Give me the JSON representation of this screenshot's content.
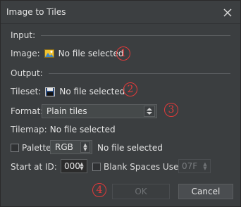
{
  "window": {
    "title": "Image to Tiles"
  },
  "input_section": {
    "label": "Input:"
  },
  "image_row": {
    "label": "Image:",
    "value": "No file selected"
  },
  "output_section": {
    "label": "Output:"
  },
  "tileset_row": {
    "label": "Tileset:",
    "value": "No file selected"
  },
  "format_row": {
    "label": "Format:",
    "selected": "Plain tiles"
  },
  "tilemap_row": {
    "label": "Tilemap:",
    "value": "No file selected"
  },
  "palette_row": {
    "label": "Palette:",
    "checked": false,
    "mode": "RGB",
    "value": "No file selected"
  },
  "start_row": {
    "label": "Start at ID:",
    "value": "000",
    "blank_label": "Blank Spaces Use ID:",
    "blank_checked": false,
    "blank_value": "07F"
  },
  "buttons": {
    "ok": "OK",
    "cancel": "Cancel"
  },
  "annotations": [
    "1",
    "2",
    "3",
    "4"
  ],
  "colors": {
    "annotation": "#e23a3a",
    "background": "#3b3e40"
  }
}
